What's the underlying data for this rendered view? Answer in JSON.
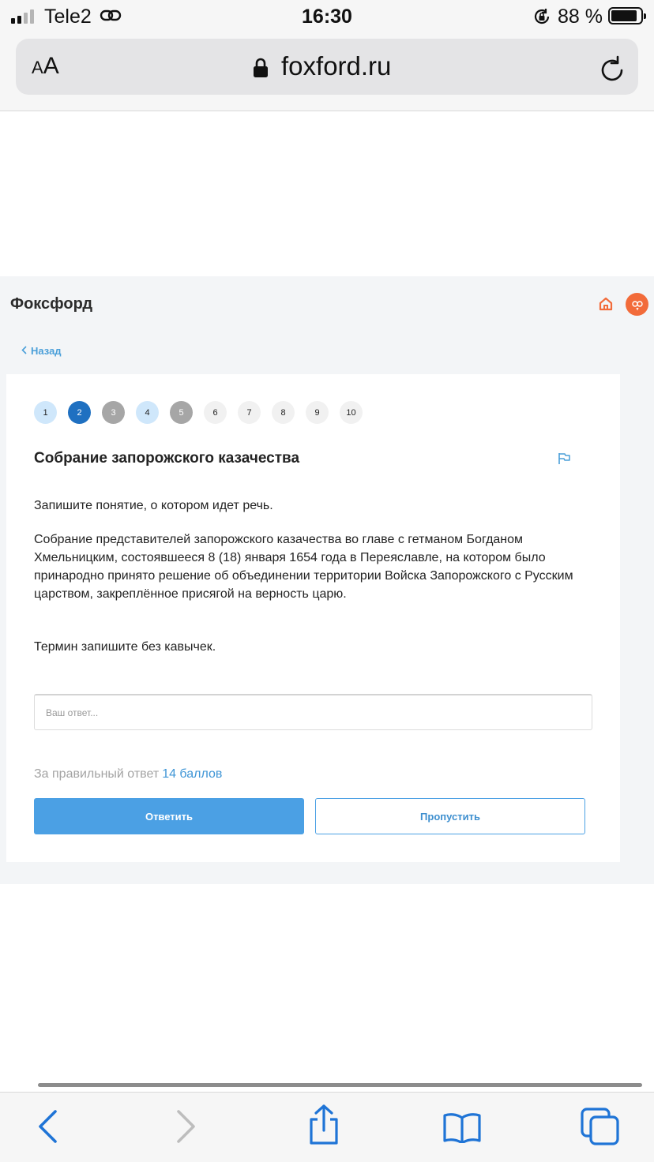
{
  "status_bar": {
    "carrier": "Tele2",
    "time": "16:30",
    "battery_percent": "88 %",
    "battery_level": 0.88
  },
  "browser": {
    "text_size_small": "A",
    "text_size_large": "A",
    "url": "foxford.ru"
  },
  "site": {
    "brand": "Фоксфорд",
    "back_label": "Назад",
    "colors": {
      "accent": "#4ba0e4",
      "current_step": "#1f70c1",
      "skipped_step": "#a6a6a6",
      "answered_step": "#cfe7fb",
      "brand_orange": "#f26b3a"
    }
  },
  "steps": [
    {
      "label": "1",
      "state": "answered"
    },
    {
      "label": "2",
      "state": "current"
    },
    {
      "label": "3",
      "state": "skipped"
    },
    {
      "label": "4",
      "state": "answered"
    },
    {
      "label": "5",
      "state": "skipped"
    },
    {
      "label": "6",
      "state": "pending"
    },
    {
      "label": "7",
      "state": "pending"
    },
    {
      "label": "8",
      "state": "pending"
    },
    {
      "label": "9",
      "state": "pending"
    },
    {
      "label": "10",
      "state": "pending"
    }
  ],
  "task": {
    "title": "Собрание запорожского казачества",
    "instruction": "Запишите понятие, о котором идет речь.",
    "body": "Собрание представителей запорожского казачества во главе с гетманом Богданом Хмельницким, состоявшееся 8 (18) января 1654 года в Переяславле, на котором было принародно принято решение об объединении территории Войска Запорожского с Русским царством, закреплённое присягой на верность царю.",
    "hint": "Термин запишите без кавычек.",
    "answer_placeholder": "Ваш ответ...",
    "answer_value": "",
    "points_prefix": "За правильный ответ",
    "points_value": "14 баллов",
    "submit_label": "Ответить",
    "skip_label": "Пропустить"
  },
  "icons": {
    "signal": "signal-icon",
    "link": "link-icon",
    "rotation_lock": "rotation-lock-icon",
    "lock": "lock-icon",
    "reload": "reload-icon",
    "home": "home-icon",
    "owl": "owl-avatar-icon",
    "back": "chevron-left-icon",
    "flag": "flag-icon",
    "toolbar": [
      "back-arrow-icon",
      "forward-arrow-icon",
      "share-icon",
      "bookmarks-icon",
      "tabs-icon"
    ]
  }
}
